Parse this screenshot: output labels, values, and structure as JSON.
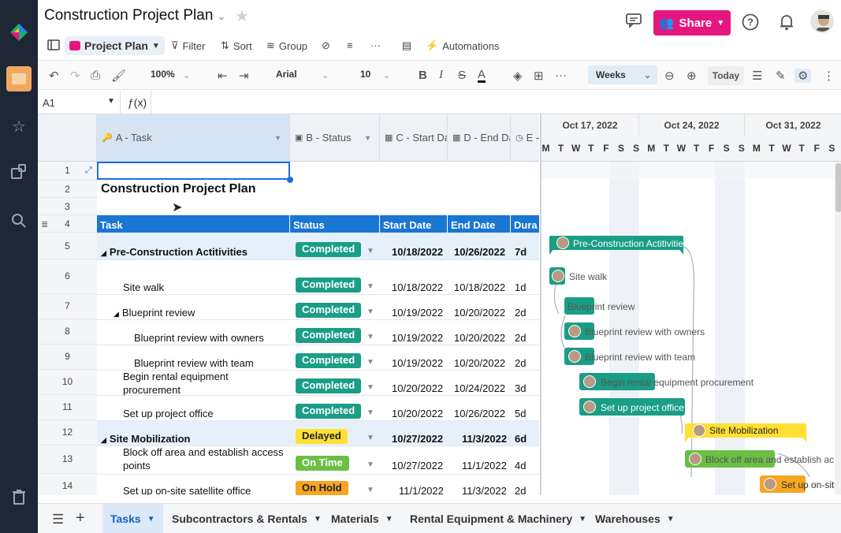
{
  "window": {
    "title": "Construction Project Plan"
  },
  "header": {
    "share_label": "Share",
    "help_icon": "help-icon",
    "bell_icon": "bell-icon"
  },
  "viewbar": {
    "project_plan_label": "Project Plan",
    "filter_label": "Filter",
    "sort_label": "Sort",
    "group_label": "Group",
    "automations_label": "Automations"
  },
  "toolbar": {
    "zoom": "100%",
    "font": "Arial",
    "size": "10",
    "weeks": "Weeks",
    "today": "Today"
  },
  "formula": {
    "cell_ref": "A1",
    "fx": "ƒ(x)"
  },
  "columns": [
    {
      "label": "A - Task"
    },
    {
      "label": "B - Status"
    },
    {
      "label": "C - Start Da"
    },
    {
      "label": "D - End Da"
    },
    {
      "label": "E -"
    }
  ],
  "sheet": {
    "title": "Construction Project Plan",
    "headers": [
      "Task",
      "Status",
      "Start Date",
      "End Date",
      "Dura"
    ],
    "rows": [
      {
        "num": "1"
      },
      {
        "num": "2"
      },
      {
        "num": "3"
      },
      {
        "num": "4"
      },
      {
        "num": "5",
        "task": "Pre-Construction Actitivities",
        "status": "Completed",
        "start": "10/18/2022",
        "end": "10/26/2022",
        "dur": "7d"
      },
      {
        "num": "6",
        "task": "Site walk",
        "status": "Completed",
        "start": "10/18/2022",
        "end": "10/18/2022",
        "dur": "1d"
      },
      {
        "num": "7",
        "task": "Blueprint review",
        "status": "Completed",
        "start": "10/19/2022",
        "end": "10/20/2022",
        "dur": "2d"
      },
      {
        "num": "8",
        "task": "Blueprint review with owners",
        "status": "Completed",
        "start": "10/19/2022",
        "end": "10/20/2022",
        "dur": "2d"
      },
      {
        "num": "9",
        "task": "Blueprint review with team",
        "status": "Completed",
        "start": "10/19/2022",
        "end": "10/20/2022",
        "dur": "2d"
      },
      {
        "num": "10",
        "task_l1": "Begin rental equipment",
        "task_l2": "procurement",
        "status": "Completed",
        "start": "10/20/2022",
        "end": "10/24/2022",
        "dur": "3d"
      },
      {
        "num": "11",
        "task": "Set up project office",
        "status": "Completed",
        "start": "10/20/2022",
        "end": "10/26/2022",
        "dur": "5d"
      },
      {
        "num": "12",
        "task": "Site Mobilization",
        "status": "Delayed",
        "start": "10/27/2022",
        "end": "11/3/2022",
        "dur": "6d"
      },
      {
        "num": "13",
        "task_l1": "Block off area and establish access",
        "task_l2": "points",
        "status": "On Time",
        "start": "10/27/2022",
        "end": "11/1/2022",
        "dur": "4d"
      },
      {
        "num": "14",
        "task": "Set up on-site satellite office",
        "status": "On Hold",
        "start": "11/1/2022",
        "end": "11/3/2022",
        "dur": "2d"
      }
    ]
  },
  "gantt": {
    "weeks": [
      "Oct 17, 2022",
      "Oct 24, 2022",
      "Oct 31, 2022"
    ],
    "days": [
      "M",
      "T",
      "W",
      "T",
      "F",
      "S",
      "S",
      "M",
      "T",
      "W",
      "T",
      "F",
      "S",
      "S",
      "M",
      "T",
      "W",
      "T",
      "F",
      "S",
      "S"
    ],
    "bars": [
      {
        "label": "Pre-Construction Actitivities"
      },
      {
        "label": "Site walk"
      },
      {
        "label": "Blueprint review"
      },
      {
        "label": "Blueprint review with owners"
      },
      {
        "label": "Blueprint review with team"
      },
      {
        "label": "Begin rental equipment procurement"
      },
      {
        "label": "Set up project office"
      },
      {
        "label": "Site Mobilization"
      },
      {
        "label": "Block off area and establish ac"
      },
      {
        "label": "Set up on-sit"
      }
    ]
  },
  "sheet_tabs": [
    {
      "label": "Tasks"
    },
    {
      "label": "Subcontractors & Rentals"
    },
    {
      "label": "Materials"
    },
    {
      "label": "Rental Equipment & Machinery"
    },
    {
      "label": "Warehouses"
    }
  ],
  "colors": {
    "completed": "#1a9e86",
    "delayed": "#ffe033",
    "on_time": "#6cbf45",
    "on_hold": "#f5a623",
    "header_blue": "#1976d2",
    "share": "#e5177e"
  }
}
